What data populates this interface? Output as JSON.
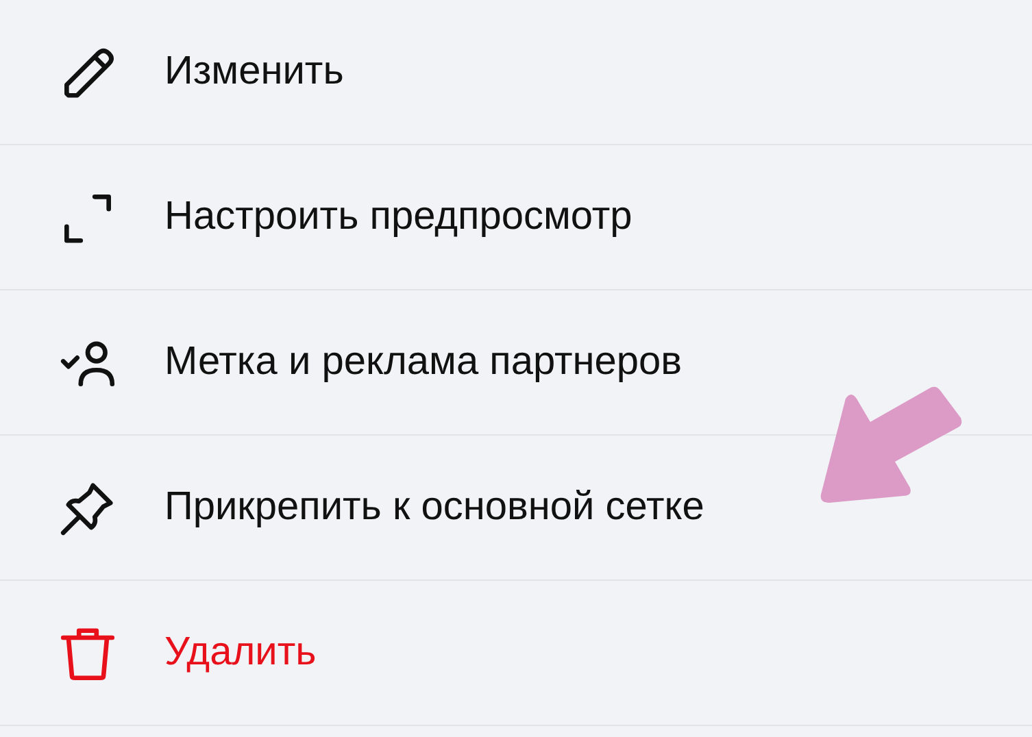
{
  "menu": {
    "items": [
      {
        "kind": "pencil",
        "label": "Изменить",
        "destructive": false
      },
      {
        "kind": "frame",
        "label": "Настроить предпросмотр",
        "destructive": false
      },
      {
        "kind": "person-check",
        "label": "Метка и реклама партнеров",
        "destructive": false
      },
      {
        "kind": "pin",
        "label": "Прикрепить к основной сетке",
        "destructive": false
      },
      {
        "kind": "trash",
        "label": "Удалить",
        "destructive": true
      }
    ]
  }
}
